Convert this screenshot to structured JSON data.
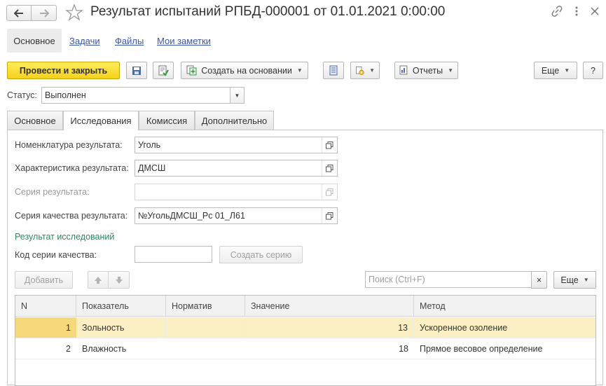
{
  "window": {
    "title": "Результат испытаний РПБД-000001 от 01.01.2021 0:00:00"
  },
  "nav_tabs": [
    "Основное",
    "Задачи",
    "Файлы",
    "Мои заметки"
  ],
  "toolbar": {
    "post_close": "Провести и закрыть",
    "create_based": "Создать на основании",
    "reports": "Отчеты",
    "more": "Еще",
    "help": "?"
  },
  "status": {
    "label": "Статус:",
    "value": "Выполнен"
  },
  "form_tabs": [
    "Основное",
    "Исследования",
    "Комиссия",
    "Дополнительно"
  ],
  "fields": {
    "nomenclature_label": "Номенклатура результата:",
    "nomenclature_value": "Уголь",
    "characteristic_label": "Характеристика результата:",
    "characteristic_value": "ДМСШ",
    "series_label": "Серия результата:",
    "series_value": "",
    "quality_series_label": "Серия качества результата:",
    "quality_series_value": "№УгольДМСШ_Рс 01_Л61"
  },
  "research": {
    "section_title": "Результат исследований",
    "code_label": "Код серии качества:",
    "code_value": "",
    "create_series_button": "Создать серию"
  },
  "table_toolbar": {
    "add_button": "Добавить",
    "search_placeholder": "Поиск (Ctrl+F)",
    "clear_symbol": "×",
    "more": "Еще"
  },
  "table": {
    "columns": [
      "N",
      "Показатель",
      "Норматив",
      "Значение",
      "Метод"
    ],
    "rows": [
      {
        "n": "1",
        "indicator": "Зольность",
        "norm": "",
        "value": "13",
        "method": "Ускоренное озоление"
      },
      {
        "n": "2",
        "indicator": "Влажность",
        "norm": "",
        "value": "18",
        "method": "Прямое весовое определение"
      }
    ]
  },
  "colors": {
    "primary_button": "#f5d11a",
    "link": "#3a56a6",
    "section_title": "#2b8a5b",
    "selected_row": "#faf0c4"
  }
}
